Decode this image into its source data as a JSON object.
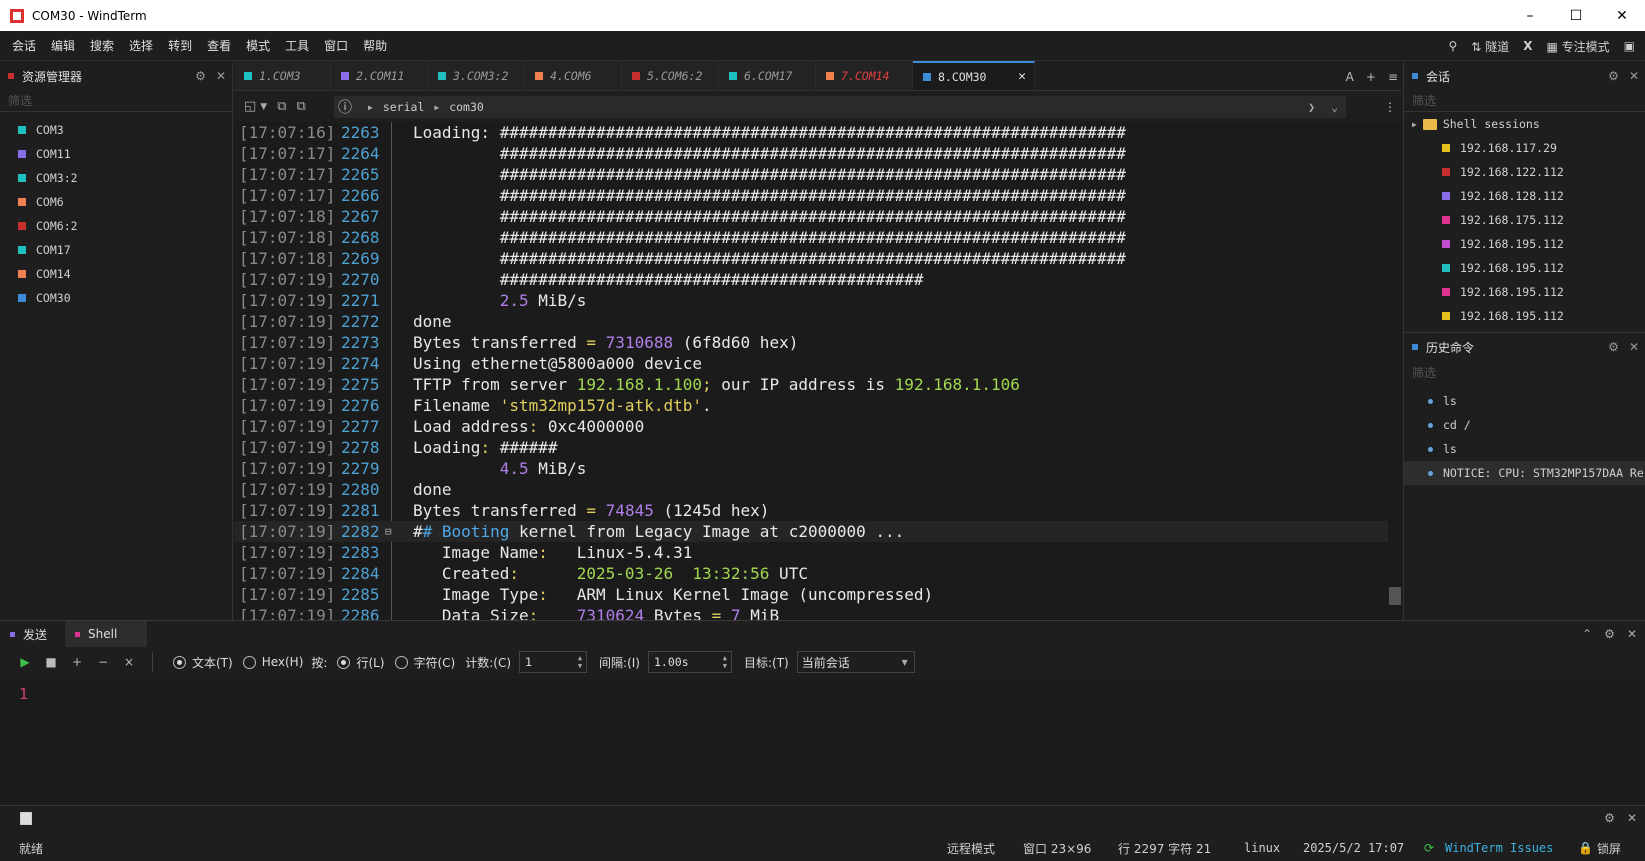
{
  "window": {
    "title": "COM30 - WindTerm"
  },
  "menu": {
    "items": [
      "会话",
      "编辑",
      "搜索",
      "选择",
      "转到",
      "查看",
      "模式",
      "工具",
      "窗口",
      "帮助"
    ],
    "tunnel": "隧道",
    "x_label": "X",
    "focus_mode": "专注模式"
  },
  "left_panel": {
    "title": "资源管理器",
    "filter_placeholder": "筛选",
    "items": [
      {
        "label": "COM3",
        "color": "#1fbfbf"
      },
      {
        "label": "COM11",
        "color": "#8a6de8"
      },
      {
        "label": "COM3:2",
        "color": "#1fbfbf"
      },
      {
        "label": "COM6",
        "color": "#f08050"
      },
      {
        "label": "COM6:2",
        "color": "#c83030"
      },
      {
        "label": "COM17",
        "color": "#1fbfbf"
      },
      {
        "label": "COM14",
        "color": "#f08050"
      },
      {
        "label": "COM30",
        "color": "#3c8cd8"
      }
    ]
  },
  "tabs": [
    {
      "label": "1.COM3",
      "color": "#1fbfbf"
    },
    {
      "label": "2.COM11",
      "color": "#8a6de8"
    },
    {
      "label": "3.COM3:2",
      "color": "#1fbfbf"
    },
    {
      "label": "4.COM6",
      "color": "#f08050"
    },
    {
      "label": "5.COM6:2",
      "color": "#c83030"
    },
    {
      "label": "6.COM17",
      "color": "#1fbfbf"
    },
    {
      "label": "7.COM14",
      "color": "#f08050",
      "text_color": "#e04040"
    },
    {
      "label": "8.COM30",
      "color": "#3c8cd8",
      "active": true
    }
  ],
  "tab_controls": {
    "font": "A",
    "add": "+",
    "menu": "≡"
  },
  "breadcrumb": {
    "items": [
      "serial",
      "com30"
    ]
  },
  "terminal": {
    "lines": [
      {
        "ts": "[17:07:16]",
        "ln": "2263",
        "parts": [
          [
            "t",
            "Loading: "
          ],
          [
            "h",
            "#################################################################"
          ]
        ]
      },
      {
        "ts": "[17:07:17]",
        "ln": "2264",
        "parts": [
          [
            "t",
            "         "
          ],
          [
            "h",
            "#################################################################"
          ]
        ]
      },
      {
        "ts": "[17:07:17]",
        "ln": "2265",
        "parts": [
          [
            "t",
            "         "
          ],
          [
            "h",
            "#################################################################"
          ]
        ]
      },
      {
        "ts": "[17:07:17]",
        "ln": "2266",
        "parts": [
          [
            "t",
            "         "
          ],
          [
            "h",
            "#################################################################"
          ]
        ]
      },
      {
        "ts": "[17:07:18]",
        "ln": "2267",
        "parts": [
          [
            "t",
            "         "
          ],
          [
            "h",
            "#################################################################"
          ]
        ]
      },
      {
        "ts": "[17:07:18]",
        "ln": "2268",
        "parts": [
          [
            "t",
            "         "
          ],
          [
            "h",
            "#################################################################"
          ]
        ]
      },
      {
        "ts": "[17:07:18]",
        "ln": "2269",
        "parts": [
          [
            "t",
            "         "
          ],
          [
            "h",
            "#################################################################"
          ]
        ]
      },
      {
        "ts": "[17:07:19]",
        "ln": "2270",
        "parts": [
          [
            "t",
            "         "
          ],
          [
            "h",
            "############################################"
          ]
        ]
      },
      {
        "ts": "[17:07:19]",
        "ln": "2271",
        "parts": [
          [
            "t",
            "         "
          ],
          [
            "n",
            "2.5"
          ],
          [
            "t",
            " MiB/s"
          ]
        ]
      },
      {
        "ts": "[17:07:19]",
        "ln": "2272",
        "parts": [
          [
            "t",
            "done"
          ]
        ]
      },
      {
        "ts": "[17:07:19]",
        "ln": "2273",
        "parts": [
          [
            "t",
            "Bytes transferred "
          ],
          [
            "s",
            "="
          ],
          [
            "t",
            " "
          ],
          [
            "n",
            "7310688"
          ],
          [
            "t",
            " (6f8d60 hex)"
          ]
        ]
      },
      {
        "ts": "[17:07:19]",
        "ln": "2274",
        "parts": [
          [
            "t",
            "Using ethernet@5800a000 device"
          ]
        ]
      },
      {
        "ts": "[17:07:19]",
        "ln": "2275",
        "parts": [
          [
            "t",
            "TFTP from server "
          ],
          [
            "i",
            "192.168.1.100"
          ],
          [
            "s",
            ";"
          ],
          [
            "t",
            " our IP address is "
          ],
          [
            "i",
            "192.168.1.106"
          ]
        ]
      },
      {
        "ts": "[17:07:19]",
        "ln": "2276",
        "parts": [
          [
            "t",
            "Filename "
          ],
          [
            "s",
            "'stm32mp157d-atk.dtb'"
          ],
          [
            "t",
            "."
          ]
        ]
      },
      {
        "ts": "[17:07:19]",
        "ln": "2277",
        "parts": [
          [
            "t",
            "Load address"
          ],
          [
            "s",
            ":"
          ],
          [
            "t",
            " 0xc4000000"
          ]
        ]
      },
      {
        "ts": "[17:07:19]",
        "ln": "2278",
        "parts": [
          [
            "t",
            "Loading"
          ],
          [
            "s",
            ":"
          ],
          [
            "t",
            " ######"
          ]
        ]
      },
      {
        "ts": "[17:07:19]",
        "ln": "2279",
        "parts": [
          [
            "t",
            "         "
          ],
          [
            "n",
            "4.5"
          ],
          [
            "t",
            " MiB/s"
          ]
        ]
      },
      {
        "ts": "[17:07:19]",
        "ln": "2280",
        "parts": [
          [
            "t",
            "done"
          ]
        ]
      },
      {
        "ts": "[17:07:19]",
        "ln": "2281",
        "parts": [
          [
            "t",
            "Bytes transferred "
          ],
          [
            "s",
            "="
          ],
          [
            "t",
            " "
          ],
          [
            "n",
            "74845"
          ],
          [
            "t",
            " (1245d hex)"
          ]
        ]
      },
      {
        "ts": "[17:07:19]",
        "ln": "2282",
        "fold": true,
        "hl": true,
        "parts": [
          [
            "t",
            "#"
          ],
          [
            "k",
            "# Booting"
          ],
          [
            "t",
            " kernel from Legacy Image at c2000000 ..."
          ]
        ]
      },
      {
        "ts": "[17:07:19]",
        "ln": "2283",
        "parts": [
          [
            "t",
            "   Image Name"
          ],
          [
            "s",
            ":"
          ],
          [
            "t",
            "   Linux-5.4.31"
          ]
        ]
      },
      {
        "ts": "[17:07:19]",
        "ln": "2284",
        "parts": [
          [
            "t",
            "   Created"
          ],
          [
            "s",
            ":"
          ],
          [
            "t",
            "      "
          ],
          [
            "i",
            "2025-03-26  13:32:56"
          ],
          [
            "t",
            " UTC"
          ]
        ]
      },
      {
        "ts": "[17:07:19]",
        "ln": "2285",
        "parts": [
          [
            "t",
            "   Image Type"
          ],
          [
            "s",
            ":"
          ],
          [
            "t",
            "   ARM Linux Kernel Image (uncompressed)"
          ]
        ]
      },
      {
        "ts": "[17:07:19]",
        "ln": "2286",
        "parts": [
          [
            "t",
            "   Data Size"
          ],
          [
            "s",
            ":"
          ],
          [
            "t",
            "    "
          ],
          [
            "n",
            "7310624"
          ],
          [
            "t",
            " Bytes "
          ],
          [
            "s",
            "="
          ],
          [
            "t",
            " "
          ],
          [
            "n",
            "7"
          ],
          [
            "t",
            " MiB"
          ]
        ]
      }
    ]
  },
  "sessions_panel": {
    "title": "会话",
    "filter_placeholder": "筛选",
    "folder": "Shell sessions",
    "items": [
      {
        "label": "192.168.117.29",
        "color": "#e8c020"
      },
      {
        "label": "192.168.122.112",
        "color": "#c83030"
      },
      {
        "label": "192.168.128.112",
        "color": "#8a6de8"
      },
      {
        "label": "192.168.175.112",
        "color": "#e03090"
      },
      {
        "label": "192.168.195.112",
        "color": "#c050d0"
      },
      {
        "label": "192.168.195.112",
        "color": "#1fbfbf"
      },
      {
        "label": "192.168.195.112",
        "color": "#e03090"
      },
      {
        "label": "192.168.195.112",
        "color": "#e8c020"
      }
    ]
  },
  "history_panel": {
    "title": "历史命令",
    "filter_placeholder": "筛选",
    "items": [
      "ls",
      "cd /",
      "ls",
      "NOTICE: CPU: STM32MP157DAA Re"
    ]
  },
  "send_panel": {
    "tabs": [
      {
        "label": "发送",
        "color": "#8a6de8"
      },
      {
        "label": "Shell",
        "color": "#e03090"
      }
    ],
    "text_mode": "文本(T)",
    "hex_mode": "Hex(H)",
    "by_label": "按:",
    "line_mode": "行(L)",
    "char_mode": "字符(C)",
    "count_label": "计数:(C)",
    "count_value": "1",
    "interval_label": "间隔:(I)",
    "interval_value": "1.00s",
    "target_label": "目标:(T)",
    "target_value": "当前会话",
    "editor_line_number": "1"
  },
  "status": {
    "ready": "就绪",
    "remote_mode": "远程模式",
    "window_size": "窗口 23×96",
    "position": "行 2297 字符 21",
    "os": "linux",
    "datetime": "2025/5/2 17:07",
    "issues_link": "WindTerm Issues",
    "lock": "锁屏"
  }
}
